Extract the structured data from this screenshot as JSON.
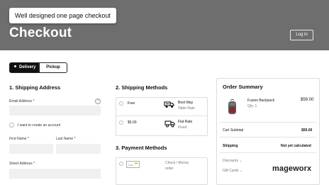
{
  "caption": "Well designed one page checkout",
  "page_title": "Checkout",
  "login_label": "Log in",
  "toggle": {
    "delivery": "Delivery",
    "pickup": "Pickup"
  },
  "shipping_address": {
    "title": "1. Shipping Address",
    "email_label": "Email Address",
    "help_icon": "?",
    "create_account_label": "I want to create an account",
    "first_name_label": "First Name",
    "last_name_label": "Last Name",
    "street_label": "Street Address",
    "required_mark": "*"
  },
  "shipping_methods": {
    "title": "2. Shipping Methods",
    "options": [
      {
        "price": "Free",
        "carrier": "Best Way",
        "method": "Table Rate",
        "icon": "delivery-truck-icon"
      },
      {
        "price": "$5.00",
        "carrier": "Flat Rate",
        "method": "Fixed",
        "icon": "truck-icon"
      }
    ]
  },
  "payment_methods": {
    "title": "3. Payment Methods",
    "options": [
      {
        "line1": "Check / Money",
        "line2": "order",
        "icon": "check-icon"
      }
    ]
  },
  "order_summary": {
    "title": "Order Summary",
    "item": {
      "name": "Fusion Backpack",
      "qty": "Qty: 1",
      "price": "$59.00",
      "image": "backpack-image"
    },
    "cart_subtotal_label": "Cart Subtotal",
    "cart_subtotal_value": "$59.00",
    "shipping_label": "Shipping",
    "shipping_value": "Not yet calculated",
    "discounts_label": "Discounts",
    "gift_cards_label": "Gift Cards"
  },
  "brand": "mageworx",
  "colors": {
    "hero_bg": "#6e6e6e",
    "required": "#d0021b",
    "input_bg": "#f0f0f0"
  }
}
